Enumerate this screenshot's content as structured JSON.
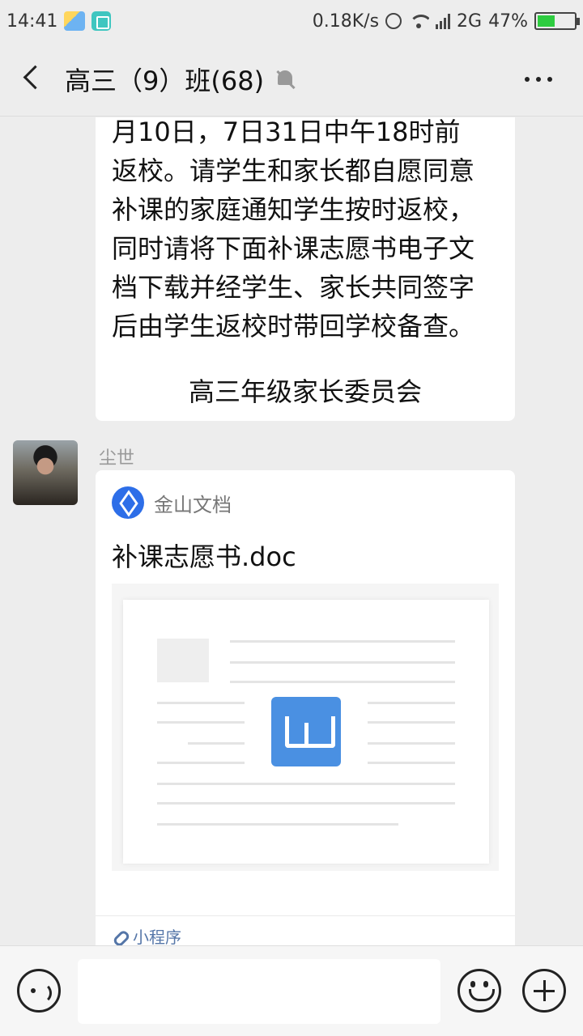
{
  "status_bar": {
    "time": "14:41",
    "network_speed": "0.18K/s",
    "network_type": "2G",
    "battery": "47%",
    "battery_level": 0.47
  },
  "header": {
    "title": "高三（9）班(68)"
  },
  "messages": {
    "prev_bubble": {
      "lines": [
        "月10日，7日31日中午18时前",
        "返校。请学生和家长都自愿同意",
        "补课的家庭通知学生按时返校，",
        "同时请将下面补课志愿书电子文",
        "档下载并经学生、家长共同签字",
        "后由学生返校时带回学校备查。"
      ],
      "signature": "高三年级家长委员会"
    },
    "card": {
      "sender": "尘世",
      "app_name": "金山文档",
      "file_title": "补课志愿书.doc",
      "footer_label": "小程序"
    }
  },
  "input_bar": {
    "placeholder": ""
  }
}
